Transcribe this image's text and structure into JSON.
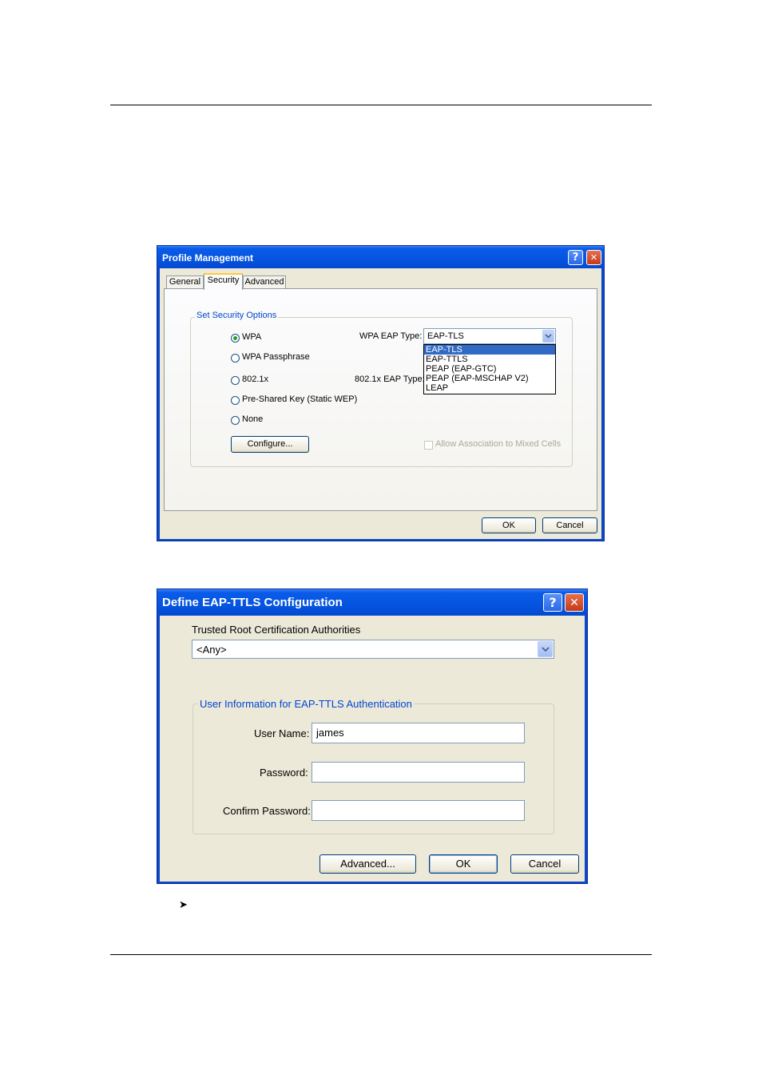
{
  "profile_dialog": {
    "title": "Profile Management",
    "help_glyph": "?",
    "close_glyph": "✕",
    "tabs": [
      {
        "label": "General"
      },
      {
        "label": "Security"
      },
      {
        "label": "Advanced"
      }
    ],
    "group_title": "Set Security Options",
    "options": [
      {
        "label": "WPA",
        "selected": true
      },
      {
        "label": "WPA Passphrase",
        "selected": false
      },
      {
        "label": "802.1x",
        "selected": false
      },
      {
        "label": "Pre-Shared Key (Static WEP)",
        "selected": false
      },
      {
        "label": "None",
        "selected": false
      }
    ],
    "wpa_eap_type_label": "WPA EAP Type:",
    "dot1x_eap_type_label": "802.1x EAP Type:",
    "eap_type_value": "EAP-TLS",
    "eap_type_options": [
      "EAP-TLS",
      "EAP-TTLS",
      "PEAP (EAP-GTC)",
      "PEAP (EAP-MSCHAP V2)",
      "LEAP"
    ],
    "configure_button": "Configure...",
    "mixed_cells_label": "Allow Association to Mixed Cells",
    "mixed_cells_checked": false,
    "ok_button": "OK",
    "cancel_button": "Cancel"
  },
  "eap_dialog": {
    "title": "Define EAP-TTLS Configuration",
    "help_glyph": "?",
    "close_glyph": "✕",
    "trusted_label": "Trusted Root Certification Authorities",
    "trusted_value": "<Any>",
    "group_title": "User Information for EAP-TTLS Authentication",
    "user_name_label": "User Name:",
    "user_name_value": "james",
    "password_label": "Password:",
    "password_value": "",
    "confirm_label": "Confirm Password:",
    "confirm_value": "",
    "advanced_button": "Advanced...",
    "ok_button": "OK",
    "cancel_button": "Cancel"
  },
  "page": {
    "bullet": "➤"
  },
  "colors": {
    "title_blue": "#0554e0",
    "dialog_face": "#ece9d8",
    "group_title": "#0046d5",
    "selection": "#316ac5"
  }
}
